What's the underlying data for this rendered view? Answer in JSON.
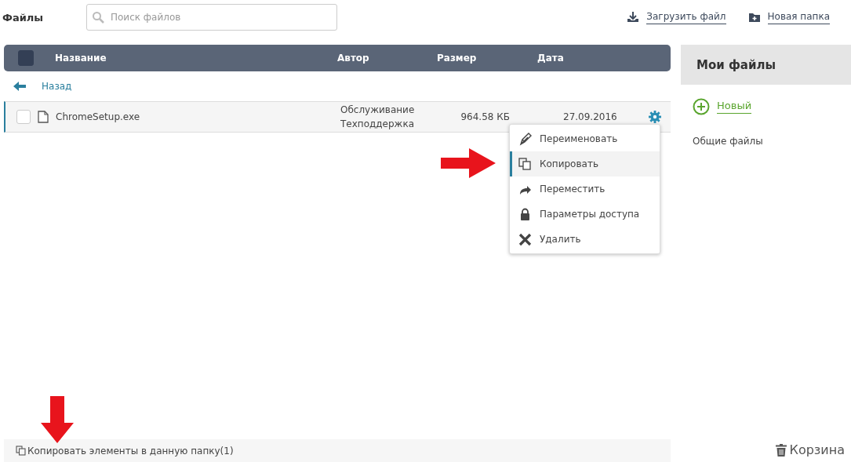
{
  "header": {
    "title": "Файлы",
    "search": {
      "placeholder": "Поиск файлов"
    },
    "actions": [
      {
        "label": "Загрузить файл",
        "kind": "upload"
      },
      {
        "label": "Новая папка",
        "kind": "folder"
      }
    ]
  },
  "table": {
    "select_all": {
      "checked": false
    },
    "columns": [
      "Название",
      "Автор",
      "Размер",
      "Дата"
    ],
    "back": "Назад",
    "rows": [
      {
        "name": "ChromeSetup.exe",
        "author": "Обслуживание Техподдержка",
        "size": "964.58 КБ",
        "date": "27.09.2016",
        "checked": false,
        "selected": true
      }
    ]
  },
  "context_menu": {
    "items": [
      {
        "label": "Переименовать",
        "kind": "rename",
        "selected": false
      },
      {
        "label": "Копировать",
        "kind": "copy",
        "selected": true
      },
      {
        "label": "Переместить",
        "kind": "move",
        "selected": false
      },
      {
        "label": "Параметры доступа",
        "kind": "lock",
        "selected": false
      },
      {
        "label": "Удалить",
        "kind": "delete",
        "selected": false
      }
    ]
  },
  "status_bar": {
    "text": "Копировать элементы в данную папку(1)"
  },
  "sidebar": {
    "title": "Мои файлы",
    "new": "Новый",
    "items": [
      "Общие файлы"
    ],
    "trash": "Корзина"
  }
}
